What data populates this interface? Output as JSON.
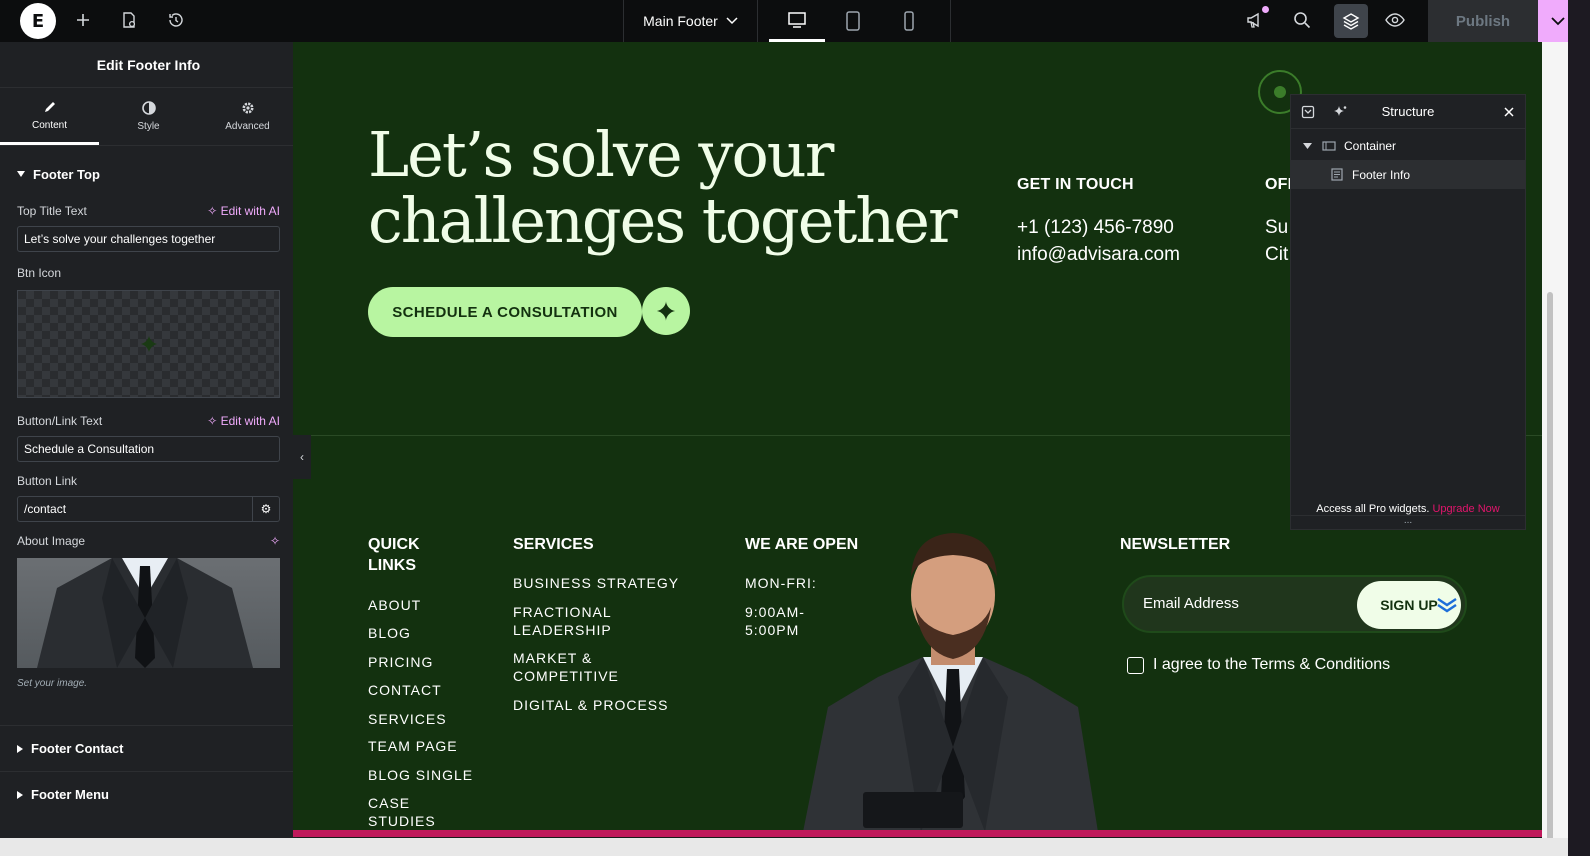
{
  "topbar": {
    "document_title": "Main Footer",
    "publish_label": "Publish",
    "devices": [
      "desktop-icon",
      "tablet-icon",
      "mobile-icon"
    ]
  },
  "panel": {
    "header": "Edit Footer Info",
    "tabs": [
      {
        "label": "Content",
        "icon": "pencil-icon"
      },
      {
        "label": "Style",
        "icon": "contrast-icon"
      },
      {
        "label": "Advanced",
        "icon": "gear-icon"
      }
    ],
    "section_open": "Footer Top",
    "fields": {
      "top_title_label": "Top Title Text",
      "top_title_value": "Let’s solve your challenges together",
      "edit_ai": "Edit with AI",
      "btn_icon_label": "Btn Icon",
      "button_text_label": "Button/Link Text",
      "button_text_value": "Schedule a Consultation",
      "button_link_label": "Button Link",
      "button_link_value": "/contact",
      "about_image_label": "About Image",
      "hint": "Set your image."
    },
    "collapsed_sections": [
      "Footer Contact",
      "Footer Menu"
    ]
  },
  "canvas": {
    "headline_line1": "Let’s solve your",
    "headline_line2": "challenges together",
    "cta_label": "SCHEDULE A CONSULTATION",
    "get_in_touch": "GET IN TOUCH",
    "phone": "+1 (123) 456-7890",
    "email": "info@advisara.com",
    "office_head": "OFI",
    "office_line1": "Su",
    "office_line2": "Cit",
    "quick_links_l1": "QUICK",
    "quick_links_l2": "LINKS",
    "quick_links": [
      "ABOUT",
      "BLOG",
      "PRICING",
      "CONTACT",
      "SERVICES",
      "TEAM PAGE",
      "BLOG SINGLE",
      "CASE",
      "STUDIES"
    ],
    "services_head": "SERVICES",
    "services": [
      "BUSINESS STRATEGY",
      "FRACTIONAL",
      "LEADERSHIP",
      "MARKET &",
      "COMPETITIVE",
      "DIGITAL & PROCESS"
    ],
    "open_head": "WE ARE OPEN",
    "open_days": "MON-FRI:",
    "open_hours1": "9:00AM-",
    "open_hours2": "5:00PM",
    "newsletter_head": "NEWSLETTER",
    "email_placeholder": "Email Address",
    "signup_label": "SIGN UP",
    "agree_text": "I agree to the Terms & Conditions"
  },
  "structure": {
    "title": "Structure",
    "items": [
      {
        "label": "Container",
        "icon": "container-icon"
      },
      {
        "label": "Footer Info",
        "icon": "widget-icon"
      }
    ],
    "promo_text": "Access all Pro widgets.",
    "promo_link": "Upgrade Now",
    "more": "..."
  },
  "colors": {
    "canvas_bg": "#13310f",
    "accent_green": "#b8f5a1",
    "brand_pink": "#f0abfc",
    "upgrade_pink": "#e2156c"
  }
}
